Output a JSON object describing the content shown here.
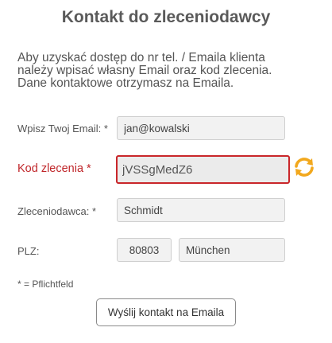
{
  "page": {
    "title": "Kontakt do zleceniodawcy",
    "intro_lines": [
      "Aby uzyskać dostęp do nr tel. / Emaila klienta",
      "należy wpisać własny Email oraz kod zlecenia.",
      "Dane kontaktowe otrzymasz na Emaila."
    ]
  },
  "form": {
    "email": {
      "label": "Wpisz Twoj Email: *",
      "value": "jan@kowalski"
    },
    "order_code": {
      "label": "Kod zlecenia *",
      "value": "jVSSgMedZ6",
      "state": "error",
      "refresh_icon": "refresh-icon"
    },
    "client": {
      "label": "Zleceniodawca: *",
      "value": "Schmidt"
    },
    "plz": {
      "label": "PLZ:",
      "postal_code": "80803",
      "city": "München"
    },
    "required_note": "* = Pflichtfeld",
    "submit_label": "Wyślij kontakt na Emaila"
  },
  "colors": {
    "error": "#c9262a",
    "field_background": "#f2f2f2",
    "refresh_icon": "#f2a81d"
  }
}
